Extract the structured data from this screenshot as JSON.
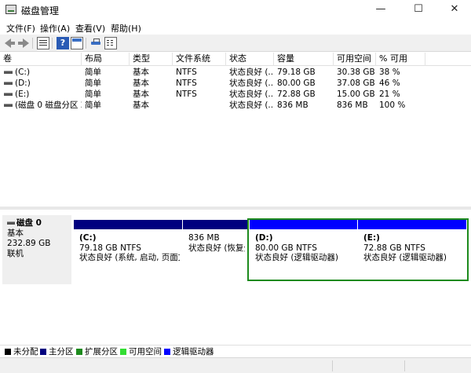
{
  "window": {
    "title": "磁盘管理",
    "minimize": "—",
    "maximize": "☐",
    "close": "✕"
  },
  "menu": [
    "文件(F)",
    "操作(A)",
    "查看(V)",
    "帮助(H)"
  ],
  "toolbar": {
    "help_glyph": "?"
  },
  "columns": [
    "卷",
    "布局",
    "类型",
    "文件系统",
    "状态",
    "容量",
    "可用空间",
    "% 可用"
  ],
  "volumes": [
    {
      "name": "(C:)",
      "layout": "简单",
      "type": "基本",
      "fs": "NTFS",
      "status": "状态良好 (...",
      "capacity": "79.18 GB",
      "free": "30.38 GB",
      "pct": "38 %"
    },
    {
      "name": "(D:)",
      "layout": "简单",
      "type": "基本",
      "fs": "NTFS",
      "status": "状态良好 (...",
      "capacity": "80.00 GB",
      "free": "37.08 GB",
      "pct": "46 %"
    },
    {
      "name": "(E:)",
      "layout": "简单",
      "type": "基本",
      "fs": "NTFS",
      "status": "状态良好 (...",
      "capacity": "72.88 GB",
      "free": "15.00 GB",
      "pct": "21 %"
    },
    {
      "name": "(磁盘 0 磁盘分区 2)",
      "layout": "简单",
      "type": "基本",
      "fs": "",
      "status": "状态良好 (...",
      "capacity": "836 MB",
      "free": "836 MB",
      "pct": "100 %"
    }
  ],
  "disk": {
    "name": "磁盘 0",
    "type": "基本",
    "size": "232.89 GB",
    "state": "联机",
    "partitions": [
      {
        "name": "(C:)",
        "size": "79.18 GB NTFS",
        "status": "状态良好 (系统, 启动, 页面文件"
      },
      {
        "name": "",
        "size": "836 MB",
        "status": "状态良好 (恢复分"
      },
      {
        "name": "(D:)",
        "size": "80.00 GB NTFS",
        "status": "状态良好 (逻辑驱动器)"
      },
      {
        "name": "(E:)",
        "size": "72.88 GB NTFS",
        "status": "状态良好 (逻辑驱动器)"
      }
    ]
  },
  "legend": [
    {
      "label": "未分配",
      "color": "#000000"
    },
    {
      "label": "主分区",
      "color": "#00007f"
    },
    {
      "label": "扩展分区",
      "color": "#1d8a1d"
    },
    {
      "label": "可用空间",
      "color": "#33dd33"
    },
    {
      "label": "逻辑驱动器",
      "color": "#0000ff"
    }
  ],
  "colors": {
    "primary_partition": "#00007f",
    "logical_drive": "#0000ff",
    "extended_frame": "#1d8a1d"
  }
}
